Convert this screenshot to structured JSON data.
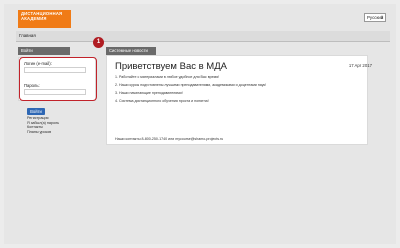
{
  "header": {
    "logo_line1": "ДИСТАНЦИОННАЯ",
    "logo_line2": "АКАДЕМИЯ",
    "language": "Русский"
  },
  "nav": {
    "home": "Главная"
  },
  "sidebar": {
    "panel_title": "Войти",
    "login_label": "Логин (e-mail):",
    "password_label": "Пароль:",
    "login_button": "Войти",
    "links": [
      "Регистрация",
      "Я забыл(а) пароль",
      "Контакты",
      "Планы уроков"
    ],
    "callout_number": "1"
  },
  "main": {
    "panel_title": "Системные новости",
    "title": "Приветствуем Вас в МДА",
    "date": "17 Apr 2017",
    "lines": [
      "1. Работайте с материалами в любое удобное для Вас время!",
      "2. Наши курсы подготовлены лучшими преподавателями, академиками и доцентами наук!",
      "3. Наши начинающие преподавателями!",
      "4. Система дистанционного обучения проста и понятна!"
    ],
    "contact": "Наши контакты 8-800-250-1740 или mycourse@shamo-projects.ru"
  },
  "colors": {
    "logo_bg": "#f07b16",
    "callout": "#c1222a",
    "button": "#2e67b4",
    "panel_head": "#6a6a6a"
  }
}
